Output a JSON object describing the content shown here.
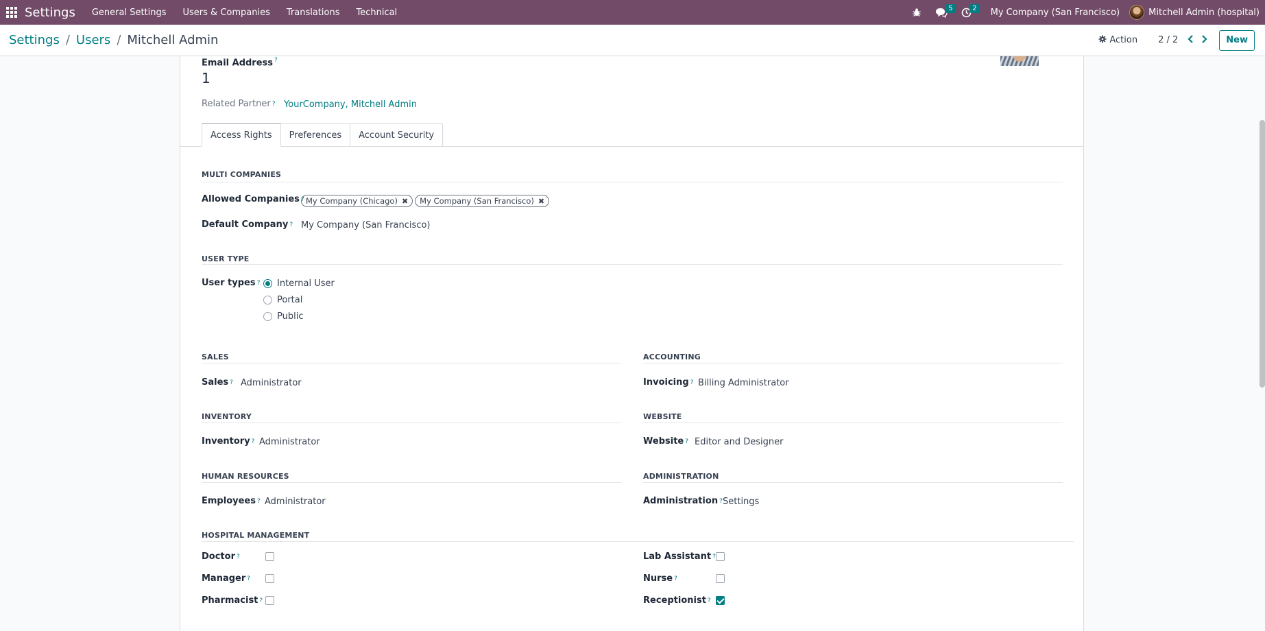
{
  "navbar": {
    "app_name": "Settings",
    "menus": [
      "General Settings",
      "Users & Companies",
      "Translations",
      "Technical"
    ],
    "messages_count": "5",
    "activities_count": "2",
    "company": "My Company (San Francisco)",
    "user": "Mitchell Admin (hospital)"
  },
  "control_panel": {
    "breadcrumb": [
      "Settings",
      "Users",
      "Mitchell Admin"
    ],
    "action_label": "Action",
    "pager": "2 / 2",
    "new_label": "New"
  },
  "form": {
    "email_label": "Email Address",
    "email_value": "1",
    "related_partner_label": "Related Partner",
    "related_partner_value": "YourCompany, Mitchell Admin",
    "help_mark": "?",
    "tabs": [
      "Access Rights",
      "Preferences",
      "Account Security"
    ],
    "multi_companies": {
      "title": "MULTI COMPANIES",
      "allowed_label": "Allowed Companies",
      "allowed_tags": [
        "My Company (Chicago)",
        "My Company (San Francisco)"
      ],
      "default_label": "Default Company",
      "default_value": "My Company (San Francisco)"
    },
    "user_type": {
      "title": "USER TYPE",
      "label": "User types",
      "options": [
        "Internal User",
        "Portal",
        "Public"
      ],
      "selected": "Internal User"
    },
    "sales": {
      "title": "SALES",
      "label": "Sales",
      "value": "Administrator"
    },
    "accounting": {
      "title": "ACCOUNTING",
      "label": "Invoicing",
      "value": "Billing Administrator"
    },
    "inventory": {
      "title": "INVENTORY",
      "label": "Inventory",
      "value": "Administrator"
    },
    "website": {
      "title": "WEBSITE",
      "label": "Website",
      "value": "Editor and Designer"
    },
    "hr": {
      "title": "HUMAN RESOURCES",
      "label": "Employees",
      "value": "Administrator"
    },
    "administration": {
      "title": "ADMINISTRATION",
      "label": "Administration",
      "value": "Settings"
    },
    "hospital": {
      "title": "HOSPITAL MANAGEMENT",
      "left": [
        {
          "label": "Doctor",
          "checked": false
        },
        {
          "label": "Manager",
          "checked": false
        },
        {
          "label": "Pharmacist",
          "checked": false
        }
      ],
      "right": [
        {
          "label": "Lab Assistant",
          "checked": false
        },
        {
          "label": "Nurse",
          "checked": false
        },
        {
          "label": "Receptionist",
          "checked": true
        }
      ]
    }
  },
  "colors": {
    "navbar": "#714b67",
    "accent": "#017e84"
  },
  "icons": [
    "apps-grid-icon",
    "bug-icon",
    "chat-icon",
    "clock-icon",
    "gear-icon",
    "chevron-left-icon",
    "chevron-right-icon",
    "close-icon"
  ]
}
